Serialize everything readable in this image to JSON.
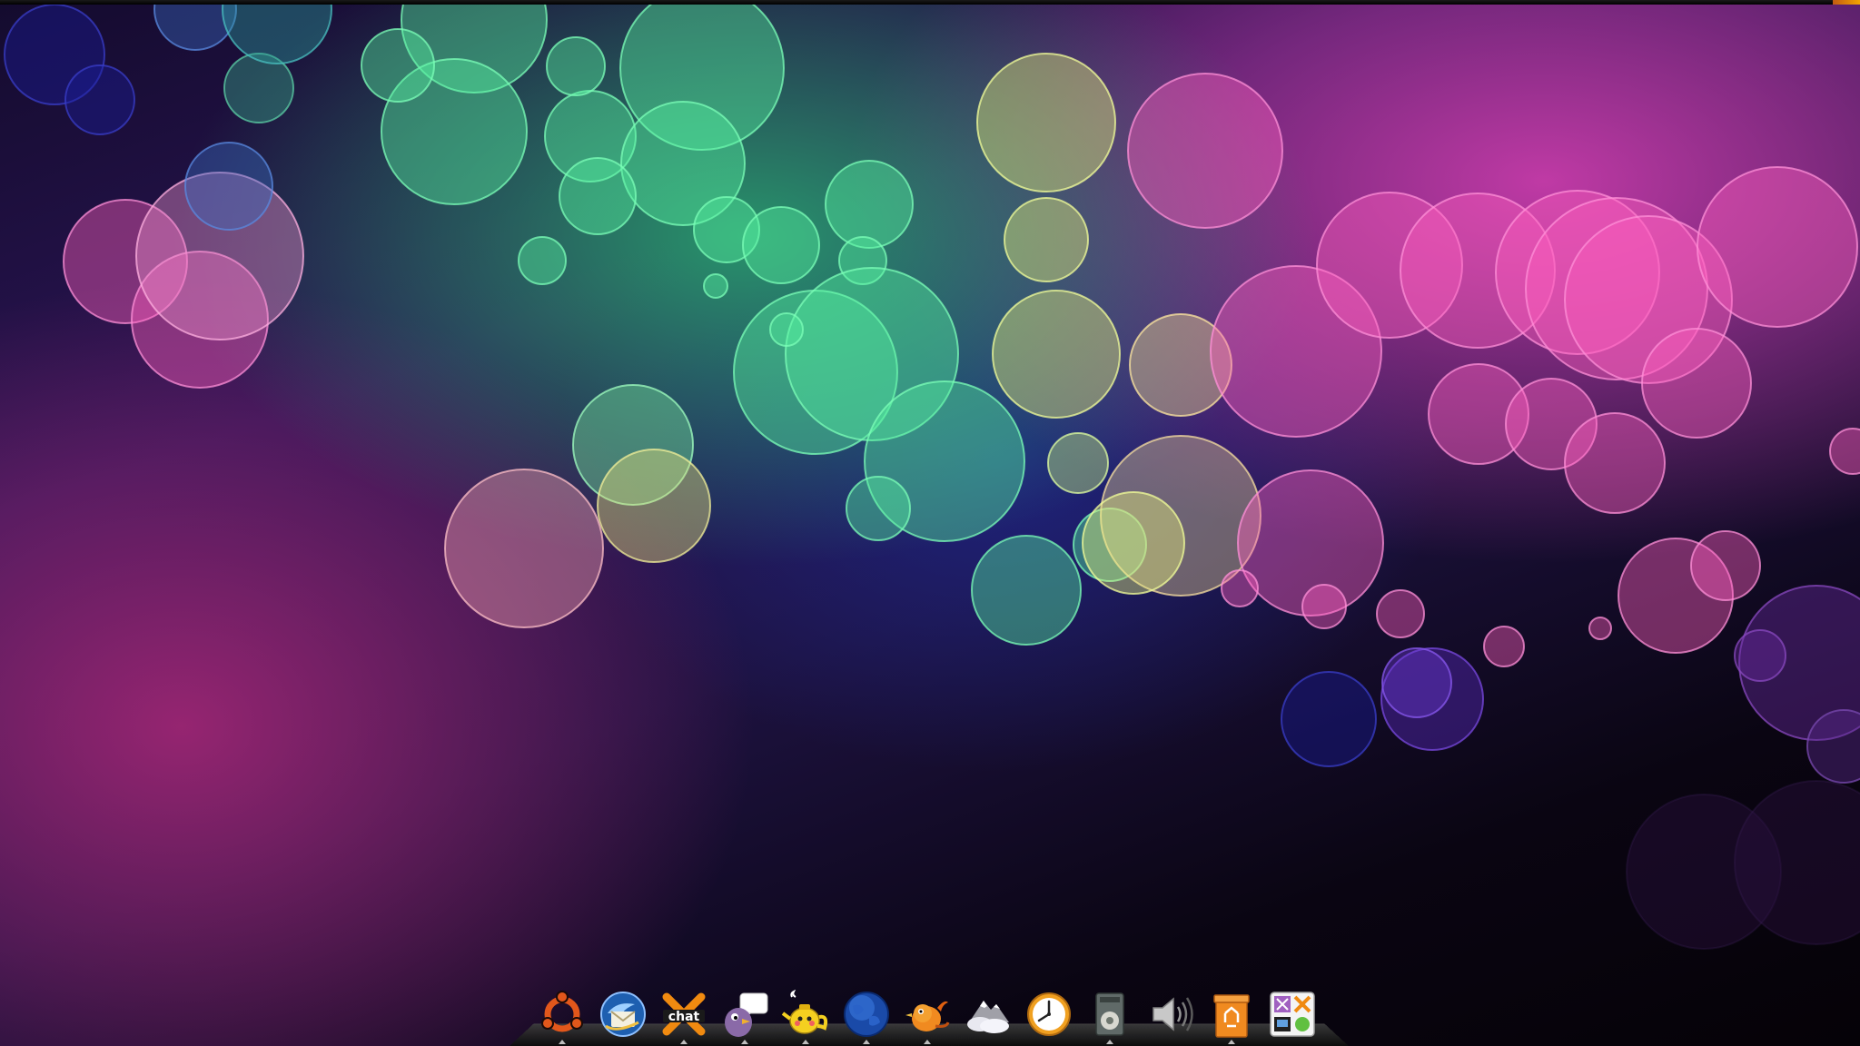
{
  "desktop": {
    "theme_colors": {
      "green": "#4be89a",
      "pink": "#ff5fbf",
      "yellow": "#d8e070",
      "navy": "#1a1d7a",
      "panel": "#000000"
    }
  },
  "dock": {
    "items": [
      {
        "icon": "ubuntu-logo-icon",
        "running": true
      },
      {
        "icon": "thunderbird-mail-icon",
        "running": false
      },
      {
        "icon": "xchat-icon",
        "label": "chat",
        "running": true
      },
      {
        "icon": "pidgin-messenger-icon",
        "running": true
      },
      {
        "icon": "teapot-icon",
        "running": true
      },
      {
        "icon": "globe-browser-icon",
        "running": true
      },
      {
        "icon": "bird-twitter-icon",
        "running": true
      },
      {
        "icon": "cloud-mountain-icon",
        "running": false
      },
      {
        "icon": "clock-icon",
        "running": false
      },
      {
        "icon": "speaker-device-icon",
        "running": true
      },
      {
        "icon": "volume-icon",
        "running": false
      },
      {
        "icon": "trash-icon",
        "running": true
      },
      {
        "icon": "settings-manager-icon",
        "running": false
      }
    ]
  }
}
